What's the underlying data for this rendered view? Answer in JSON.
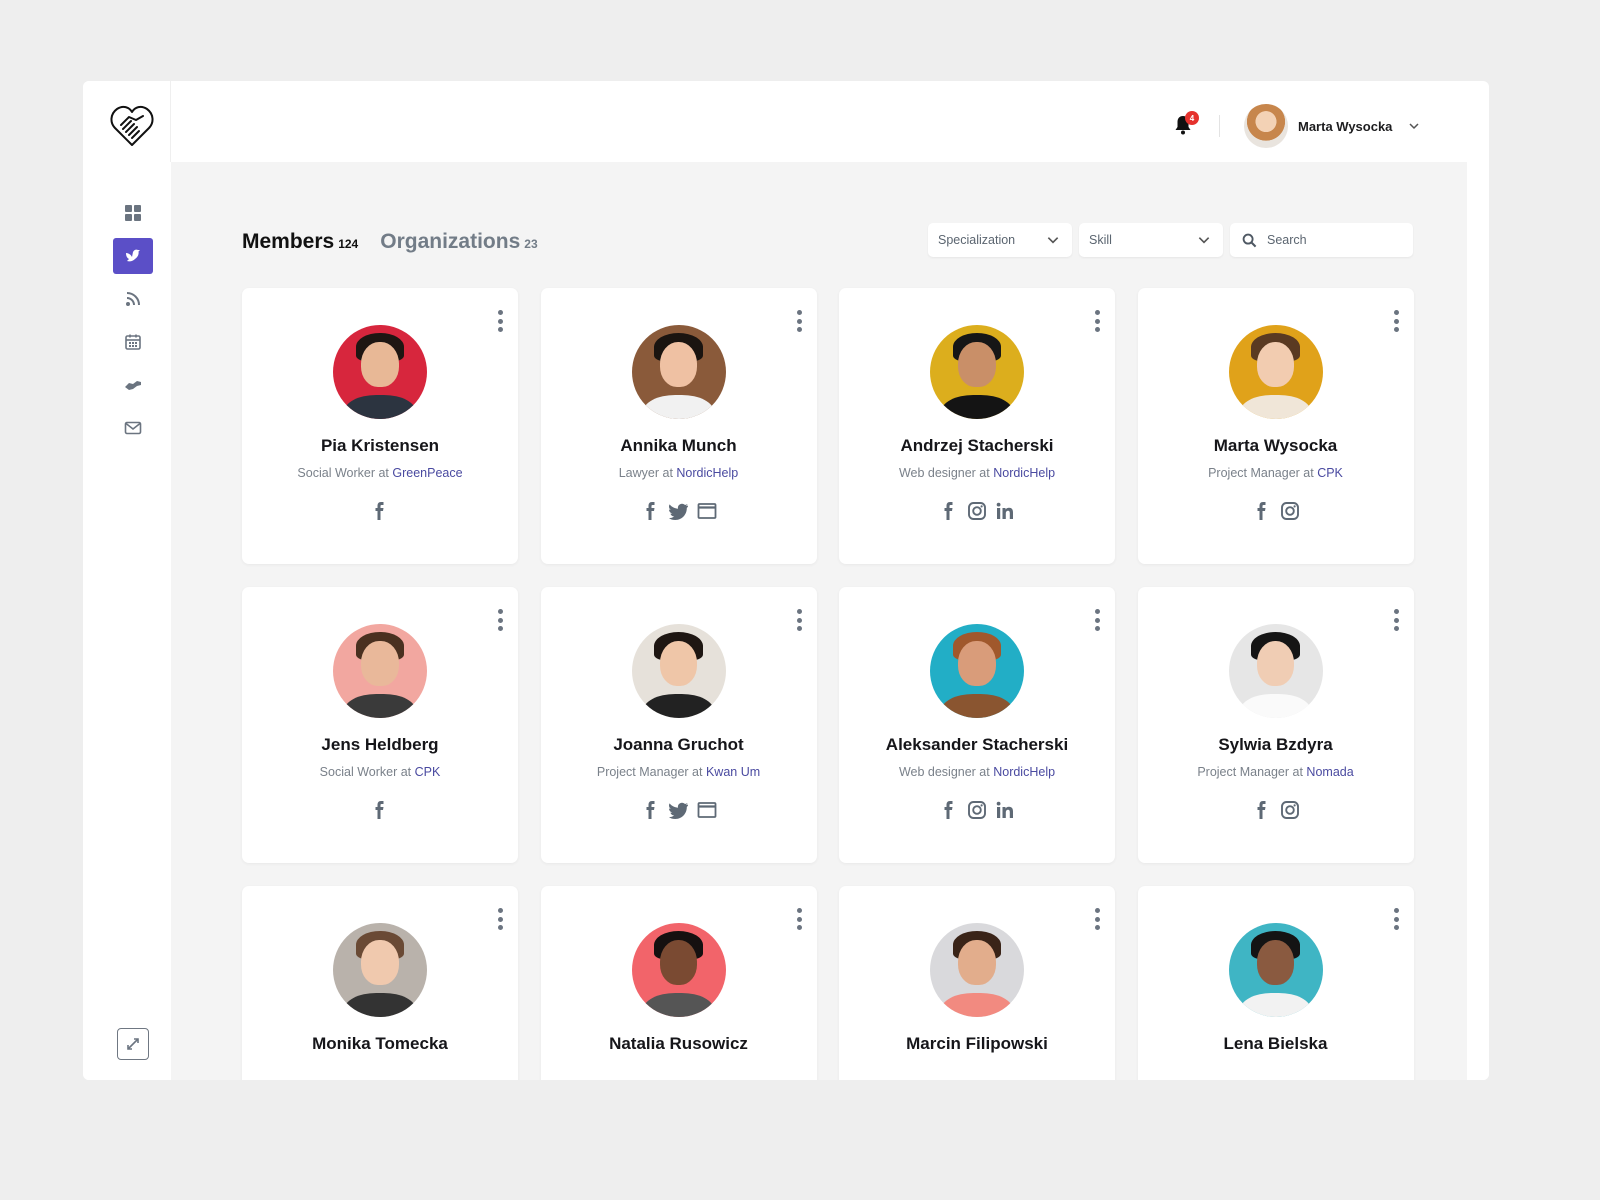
{
  "header": {
    "notifications_count": "4",
    "user_name": "Marta Wysocka"
  },
  "sidebar": {
    "items": [
      {
        "name": "dashboard",
        "icon": "grid-icon",
        "active": false
      },
      {
        "name": "members",
        "icon": "dove-icon",
        "active": true
      },
      {
        "name": "feed",
        "icon": "rss-icon",
        "active": false
      },
      {
        "name": "calendar",
        "icon": "calendar-icon",
        "active": false
      },
      {
        "name": "partnerships",
        "icon": "handshake-icon",
        "active": false
      },
      {
        "name": "messages",
        "icon": "mail-icon",
        "active": false
      }
    ],
    "expand_icon": "expand-icon"
  },
  "tabs": [
    {
      "label": "Members",
      "count": "124",
      "active": true
    },
    {
      "label": "Organizations",
      "count": "23",
      "active": false
    }
  ],
  "filters": {
    "specialization": "Specialization",
    "skill": "Skill",
    "search_placeholder": "Search"
  },
  "colors": {
    "accent": "#5b4fc7",
    "link": "#4a4aa0",
    "badge": "#e5322d"
  },
  "members": [
    {
      "name": "Pia Kristensen",
      "role": "Social Worker at ",
      "org": "GreenPeace",
      "socials": [
        "facebook"
      ],
      "bg": "#d7263d",
      "skin": "#e8b896",
      "hair": "#1e1612",
      "shirt": "#2c3440"
    },
    {
      "name": "Annika Munch",
      "role": "Lawyer at ",
      "org": "NordicHelp",
      "socials": [
        "facebook",
        "twitter",
        "website"
      ],
      "bg": "#8a5a3a",
      "skin": "#efc1a3",
      "hair": "#1a1410",
      "shirt": "#f1f1f1"
    },
    {
      "name": "Andrzej Stacherski",
      "role": "Web designer at ",
      "org": "NordicHelp",
      "socials": [
        "facebook",
        "instagram",
        "linkedin"
      ],
      "bg": "#dcae1d",
      "skin": "#c98f68",
      "hair": "#161616",
      "shirt": "#141414"
    },
    {
      "name": "Marta Wysocka",
      "role": "Project Manager at ",
      "org": "CPK",
      "socials": [
        "facebook",
        "instagram"
      ],
      "bg": "#e0a21a",
      "skin": "#f2ccb0",
      "hair": "#5a3a22",
      "shirt": "#f0e6d8"
    },
    {
      "name": "Jens Heldberg",
      "role": "Social Worker at ",
      "org": "CPK",
      "socials": [
        "facebook"
      ],
      "bg": "#f2a7a0",
      "skin": "#e9b89a",
      "hair": "#4a3020",
      "shirt": "#3a3a3a"
    },
    {
      "name": "Joanna Gruchot",
      "role": "Project Manager at ",
      "org": "Kwan Um",
      "socials": [
        "facebook",
        "twitter",
        "website"
      ],
      "bg": "#e6e1da",
      "skin": "#efc6a8",
      "hair": "#1e1612",
      "shirt": "#222222"
    },
    {
      "name": "Aleksander Stacherski",
      "role": "Web designer at ",
      "org": "NordicHelp",
      "socials": [
        "facebook",
        "instagram",
        "linkedin"
      ],
      "bg": "#22aec6",
      "skin": "#d99c7a",
      "hair": "#a0582c",
      "shirt": "#8a5530"
    },
    {
      "name": "Sylwia Bzdyra",
      "role": "Project Manager at ",
      "org": "Nomada",
      "socials": [
        "facebook",
        "instagram"
      ],
      "bg": "#e6e6e6",
      "skin": "#f0cdb4",
      "hair": "#151515",
      "shirt": "#fafafa"
    },
    {
      "name": "Monika Tomecka",
      "role": "",
      "org": "",
      "socials": [],
      "bg": "#b9b2ab",
      "skin": "#f0c9ae",
      "hair": "#6a4a35",
      "shirt": "#333333"
    },
    {
      "name": "Natalia Rusowicz",
      "role": "",
      "org": "",
      "socials": [],
      "bg": "#f2646a",
      "skin": "#7a4a32",
      "hair": "#151010",
      "shirt": "#555555"
    },
    {
      "name": "Marcin Filipowski",
      "role": "",
      "org": "",
      "socials": [],
      "bg": "#d9d9dc",
      "skin": "#e2ad8c",
      "hair": "#3a2418",
      "shirt": "#f28a80"
    },
    {
      "name": "Lena Bielska",
      "role": "",
      "org": "",
      "socials": [],
      "bg": "#3fb5c4",
      "skin": "#8a5a40",
      "hair": "#141414",
      "shirt": "#f2f2f2"
    }
  ]
}
